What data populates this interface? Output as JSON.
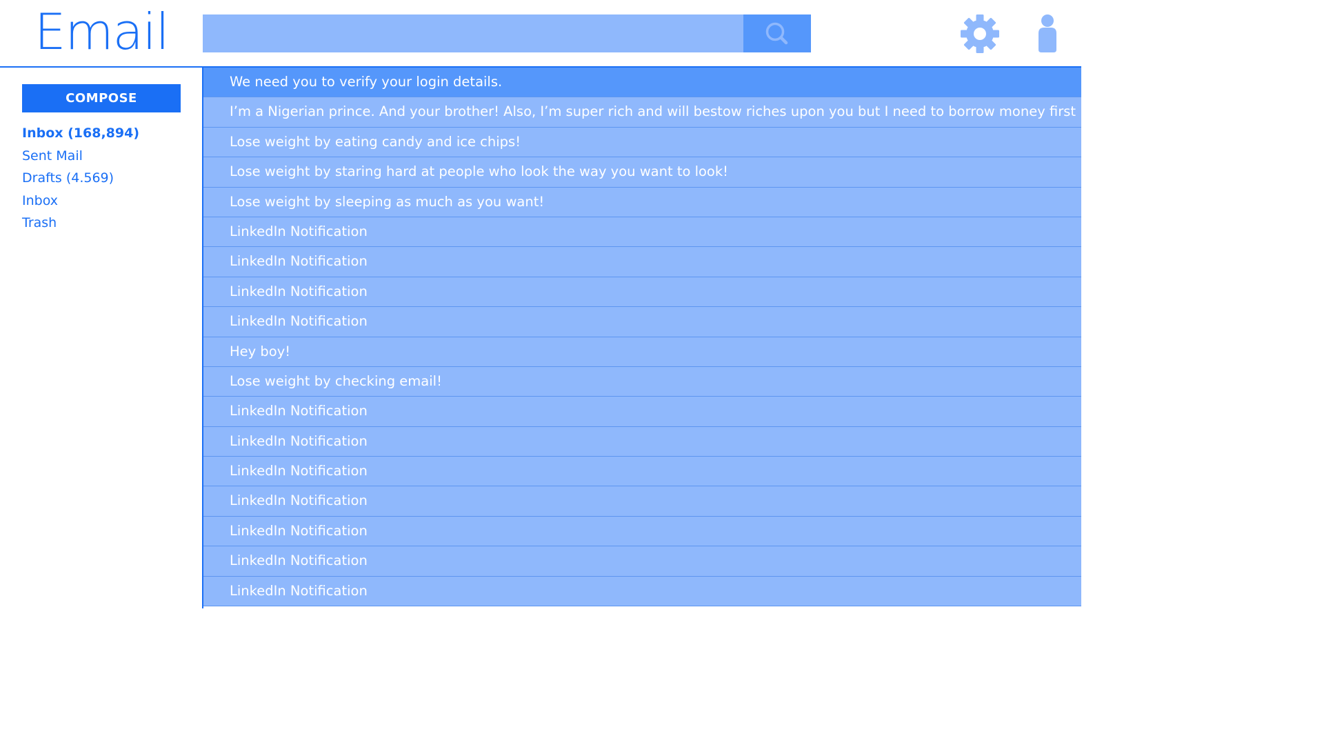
{
  "app": {
    "title": "Email"
  },
  "search": {
    "placeholder": "",
    "value": ""
  },
  "icons": {
    "search": "magnifier-icon",
    "settings": "gear-icon",
    "account": "user-icon"
  },
  "colors": {
    "primary": "#1a6ff5",
    "search_field": "#8fb8fc",
    "search_button": "#5597fb",
    "row_bg": "#8fb8fc",
    "row_selected": "#5597fb",
    "row_text": "#ffffff"
  },
  "sidebar": {
    "compose_label": "COMPOSE",
    "folders": [
      {
        "label": "Inbox (168,894)",
        "active": true
      },
      {
        "label": "Sent Mail",
        "active": false
      },
      {
        "label": "Drafts (4.569)",
        "active": false
      },
      {
        "label": "Inbox",
        "active": false
      },
      {
        "label": "Trash",
        "active": false
      }
    ]
  },
  "messages": [
    {
      "subject": "We need you to verify your login details.",
      "selected": true
    },
    {
      "subject": "I’m a Nigerian prince.  And your brother!  Also, I’m super rich and will bestow riches upon you but I need to borrow money first",
      "selected": false
    },
    {
      "subject": "Lose weight by eating candy and ice chips!",
      "selected": false
    },
    {
      "subject": "Lose weight by staring hard at people who look the way you want to look!",
      "selected": false
    },
    {
      "subject": "Lose weight by sleeping as much as you want!",
      "selected": false
    },
    {
      "subject": "LinkedIn Notification",
      "selected": false
    },
    {
      "subject": "LinkedIn Notification",
      "selected": false
    },
    {
      "subject": "LinkedIn Notification",
      "selected": false
    },
    {
      "subject": "LinkedIn Notification",
      "selected": false
    },
    {
      "subject": "Hey boy!",
      "selected": false
    },
    {
      "subject": "Lose weight by checking email!",
      "selected": false
    },
    {
      "subject": "LinkedIn Notification",
      "selected": false
    },
    {
      "subject": "LinkedIn Notification",
      "selected": false
    },
    {
      "subject": "LinkedIn Notification",
      "selected": false
    },
    {
      "subject": "LinkedIn Notification",
      "selected": false
    },
    {
      "subject": "LinkedIn Notification",
      "selected": false
    },
    {
      "subject": "LinkedIn Notification",
      "selected": false
    },
    {
      "subject": "LinkedIn Notification",
      "selected": false
    }
  ]
}
